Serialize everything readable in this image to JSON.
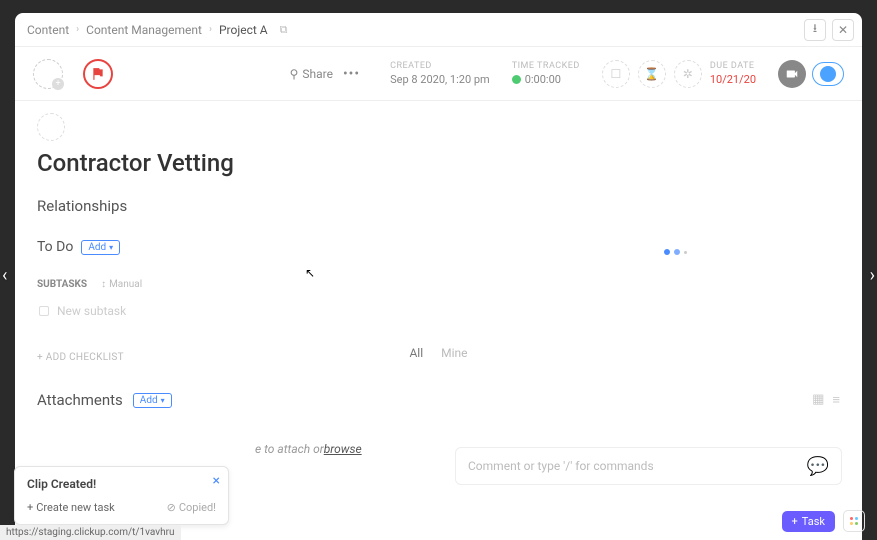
{
  "breadcrumb": {
    "root": "Content",
    "mid": "Content Management",
    "leaf": "Project A"
  },
  "header": {
    "share": "Share",
    "created_label": "CREATED",
    "created_value": "Sep 8 2020, 1:20 pm",
    "time_label": "TIME TRACKED",
    "time_value": "0:00:00",
    "due_label": "DUE DATE",
    "due_value": "10/21/20"
  },
  "task": {
    "title": "Contractor Vetting",
    "relationships": "Relationships",
    "status": "To Do",
    "add": "Add",
    "tabs": {
      "all": "All",
      "mine": "Mine"
    },
    "subtasks_label": "SUBTASKS",
    "manual": "Manual",
    "new_subtask_placeholder": "New subtask",
    "add_checklist": "+ ADD CHECKLIST",
    "attachments": "Attachments",
    "attach_add": "Add"
  },
  "footer": {
    "drop_prefix": "e to attach or ",
    "drop_link": "browse",
    "comment_placeholder": "Comment or type '/' for commands"
  },
  "toast": {
    "title": "Clip Created!",
    "create": "Create new task",
    "copied": "Copied!"
  },
  "url": "https://staging.clickup.com/t/1vavhru",
  "bottom": {
    "task": "Task"
  }
}
